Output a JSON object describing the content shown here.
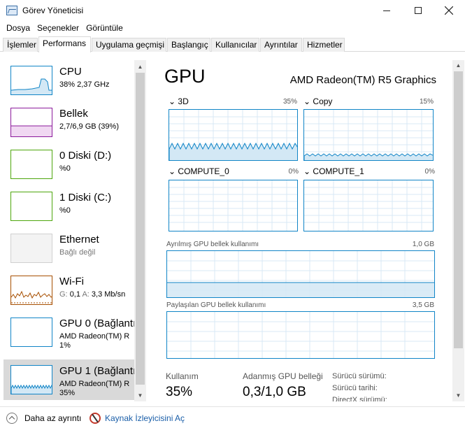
{
  "window": {
    "title": "Görev Yöneticisi"
  },
  "menu": [
    "Dosya",
    "Seçenekler",
    "Görüntüle"
  ],
  "tabs": [
    "İşlemler",
    "Performans",
    "Uygulama geçmişi",
    "Başlangıç",
    "Kullanıcılar",
    "Ayrıntılar",
    "Hizmetler"
  ],
  "active_tab": "Performans",
  "sidebar": {
    "items": [
      {
        "name": "CPU",
        "sub": "38% 2,37 GHz",
        "color": "#1185c7"
      },
      {
        "name": "Bellek",
        "sub": "2,7/6,9 GB (39%)",
        "color": "#8b1a9b"
      },
      {
        "name": "0 Diski (D:)",
        "sub": "%0",
        "color": "#4da60c"
      },
      {
        "name": "1 Diski (C:)",
        "sub": "%0",
        "color": "#4da60c"
      },
      {
        "name": "Ethernet",
        "sub": "Bağlı değil",
        "color": "#a7a7a7"
      },
      {
        "name": "Wi-Fi",
        "sub_g_label": "G:",
        "sub_g": "0,1",
        "sub_a_label": "A:",
        "sub_a": "3,3 Mb/sn",
        "color": "#a74f01"
      },
      {
        "name": "GPU 0 (Bağlantı",
        "sub": "AMD Radeon(TM) R",
        "sub2": "1%",
        "color": "#1185c7"
      },
      {
        "name": "GPU 1 (Bağlantı",
        "sub": "AMD Radeon(TM) R",
        "sub2": "35%",
        "color": "#1185c7"
      }
    ]
  },
  "main": {
    "title": "GPU",
    "model": "AMD Radeon(TM) R5 Graphics",
    "engines": [
      {
        "label": "3D",
        "pct": "35%"
      },
      {
        "label": "Copy",
        "pct": "15%"
      },
      {
        "label": "COMPUTE_0",
        "pct": "0%"
      },
      {
        "label": "COMPUTE_1",
        "pct": "0%"
      }
    ],
    "dedicated": {
      "label": "Ayrılmış GPU bellek kullanımı",
      "max": "1,0 GB"
    },
    "shared": {
      "label": "Paylaşılan GPU bellek kullanımı",
      "max": "3,5 GB"
    },
    "stats": {
      "usage_label": "Kullanım",
      "usage_value": "35%",
      "dedicated_label": "Adanmış GPU belleği",
      "dedicated_value": "0,3/1,0 GB",
      "driver_version": "Sürücü sürümü:",
      "driver_date": "Sürücü tarihi:",
      "directx": "DirectX sürümü:"
    }
  },
  "footer": {
    "fewer_details": "Daha az ayrıntı",
    "open_monitor": "Kaynak İzleyicisini Aç"
  },
  "colors": {
    "accent": "#1185c7",
    "selected_bg": "#d9d9d9"
  }
}
